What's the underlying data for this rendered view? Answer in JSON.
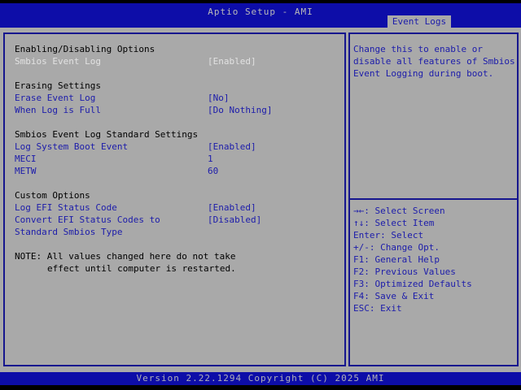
{
  "colors": {
    "header_blue": "#0d0da8",
    "body_gray": "#a9a9a9",
    "text_blue": "#1c1caa",
    "border_navy": "#16168e",
    "selected_text": "#e2e2e2",
    "black_text": "#000000",
    "title_text": "#b9b9b9",
    "footer_text": "#b0b0b8"
  },
  "header": {
    "title": "Aptio Setup - AMI",
    "active_tab": "Event Logs"
  },
  "left_panel": {
    "rows": [
      {
        "type": "section",
        "label": "Enabling/Disabling Options",
        "value": ""
      },
      {
        "type": "option-selected",
        "label": "Smbios Event Log",
        "value": "[Enabled]"
      },
      {
        "type": "blank",
        "label": "",
        "value": ""
      },
      {
        "type": "section",
        "label": "Erasing Settings",
        "value": ""
      },
      {
        "type": "option",
        "label": "Erase Event Log",
        "value": "[No]"
      },
      {
        "type": "option",
        "label": "When Log is Full",
        "value": "[Do Nothing]"
      },
      {
        "type": "blank",
        "label": "",
        "value": ""
      },
      {
        "type": "section",
        "label": "Smbios Event Log Standard Settings",
        "value": ""
      },
      {
        "type": "option",
        "label": "Log System Boot Event",
        "value": "[Enabled]"
      },
      {
        "type": "option",
        "label": "MECI",
        "value": "1"
      },
      {
        "type": "option",
        "label": "METW",
        "value": "60"
      },
      {
        "type": "blank",
        "label": "",
        "value": ""
      },
      {
        "type": "section",
        "label": "Custom Options",
        "value": ""
      },
      {
        "type": "option",
        "label": "Log EFI Status Code",
        "value": "[Enabled]"
      },
      {
        "type": "option",
        "label": "Convert EFI Status Codes to",
        "value": "[Disabled]"
      },
      {
        "type": "option-continued",
        "label": "Standard Smbios Type",
        "value": ""
      },
      {
        "type": "blank",
        "label": "",
        "value": ""
      },
      {
        "type": "note",
        "label": "NOTE: All values changed here do not take",
        "value": ""
      },
      {
        "type": "note-continued",
        "label": "effect until computer is restarted.",
        "value": ""
      }
    ]
  },
  "right_panel": {
    "help_text": [
      "Change this to enable or",
      "disable all features of Smbios",
      "Event Logging during boot."
    ],
    "hotkeys": [
      "→←: Select Screen",
      "↑↓: Select Item",
      "Enter: Select",
      "+/-: Change Opt.",
      "F1: General Help",
      "F2: Previous Values",
      "F3: Optimized Defaults",
      "F4: Save & Exit",
      "ESC: Exit"
    ]
  },
  "footer": {
    "version_text": "Version 2.22.1294 Copyright (C) 2025 AMI"
  }
}
